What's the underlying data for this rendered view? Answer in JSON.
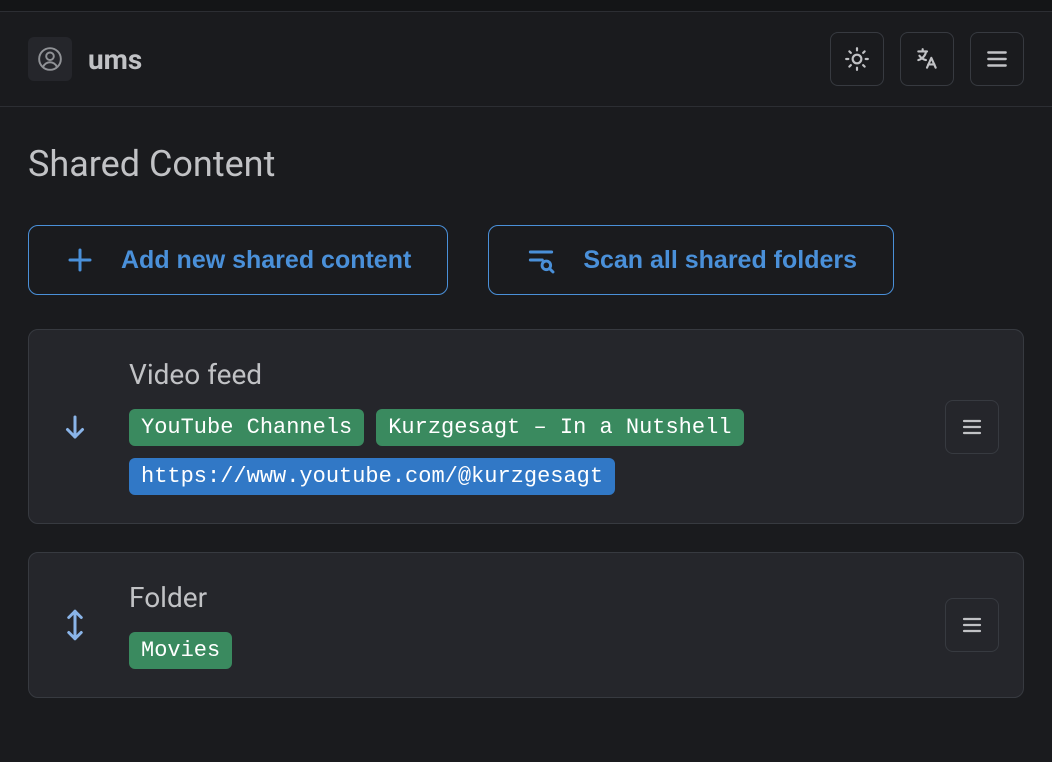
{
  "header": {
    "title": "ums"
  },
  "page": {
    "title": "Shared Content"
  },
  "actions": {
    "add_label": "Add new shared content",
    "scan_label": "Scan all shared folders"
  },
  "items": [
    {
      "title": "Video feed",
      "chips": [
        {
          "text": "YouTube Channels",
          "color": "green"
        },
        {
          "text": "Kurzgesagt – In a Nutshell",
          "color": "green"
        },
        {
          "text": "https://www.youtube.com/@kurzgesagt",
          "color": "blue"
        }
      ],
      "drag_mode": "down"
    },
    {
      "title": "Folder",
      "chips": [
        {
          "text": "Movies",
          "color": "green"
        }
      ],
      "drag_mode": "both"
    }
  ]
}
